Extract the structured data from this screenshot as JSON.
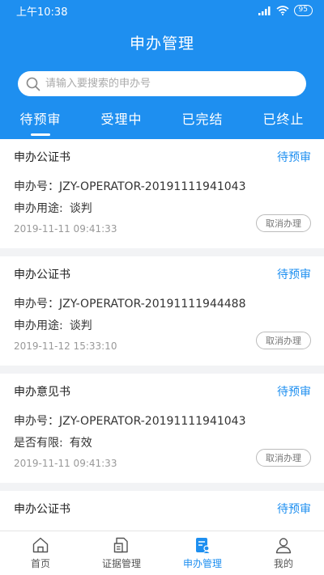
{
  "status_bar": {
    "time": "上午10:38",
    "battery": "95"
  },
  "header": {
    "title": "申办管理"
  },
  "search": {
    "placeholder": "请输入要搜索的申办号"
  },
  "tabs": [
    {
      "label": "待预审",
      "active": true
    },
    {
      "label": "受理中",
      "active": false
    },
    {
      "label": "已完结",
      "active": false
    },
    {
      "label": "已终止",
      "active": false
    }
  ],
  "cards": [
    {
      "title": "申办公证书",
      "status": "待预审",
      "l1_label": "申办号：",
      "l1_value": "JZY-OPERATOR-20191111941043",
      "l2_label": "申办用途:",
      "l2_value": "谈判",
      "date": "2019-11-11 09:41:33",
      "cancel_label": "取消办理"
    },
    {
      "title": "申办公证书",
      "status": "待预审",
      "l1_label": "申办号：",
      "l1_value": "JZY-OPERATOR-20191111944488",
      "l2_label": "申办用途:",
      "l2_value": "谈判",
      "date": "2019-11-12 15:33:10",
      "cancel_label": "取消办理"
    },
    {
      "title": "申办意见书",
      "status": "待预审",
      "l1_label": "申办号：",
      "l1_value": "JZY-OPERATOR-20191111941043",
      "l2_label": "是否有限:",
      "l2_value": "有效",
      "date": "2019-11-11 09:41:33",
      "cancel_label": "取消办理"
    },
    {
      "title": "申办公证书",
      "status": "待预审"
    }
  ],
  "bottom_nav": [
    {
      "label": "首页",
      "icon": "home-icon"
    },
    {
      "label": "证据管理",
      "icon": "evidence-icon"
    },
    {
      "label": "申办管理",
      "icon": "application-icon",
      "active": true
    },
    {
      "label": "我的",
      "icon": "user-icon"
    }
  ],
  "colors": {
    "primary": "#1e8ff0",
    "background": "#f2f3f5"
  }
}
